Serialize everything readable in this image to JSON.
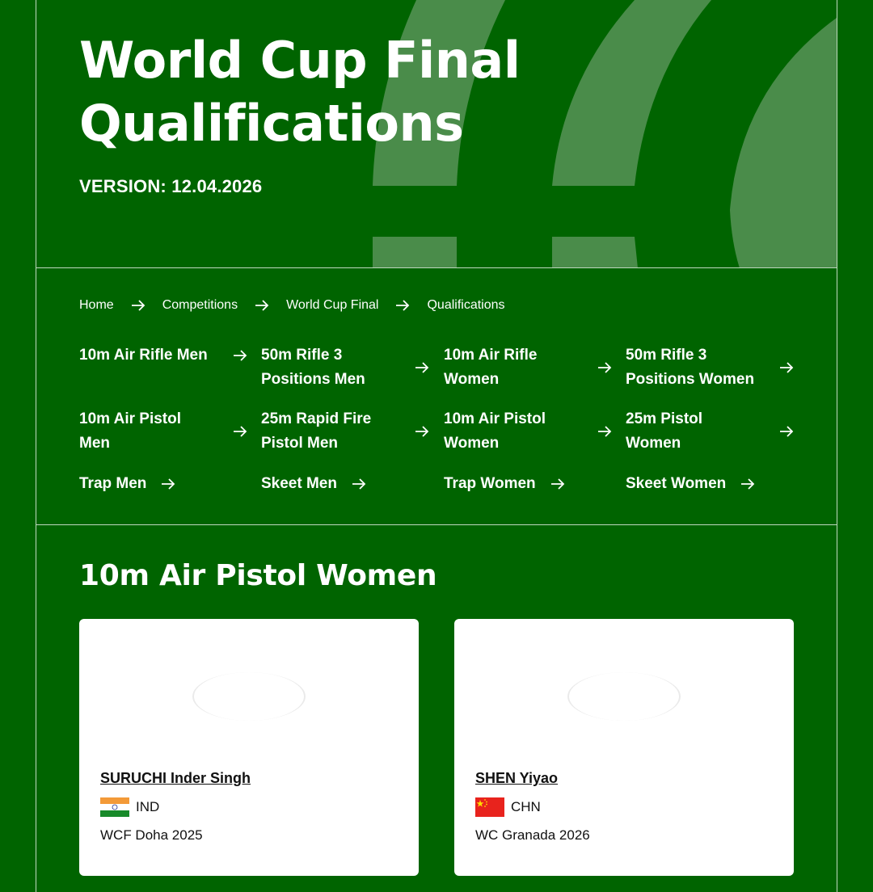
{
  "hero": {
    "title_line1": "World Cup Final",
    "title_line2": "Qualifications",
    "version": "VERSION: 12.04.2026"
  },
  "breadcrumb": [
    {
      "label": "Home"
    },
    {
      "label": "Competitions"
    },
    {
      "label": "World Cup Final"
    },
    {
      "label": "Qualifications"
    }
  ],
  "categories": [
    {
      "label": "10m Air Rifle Men"
    },
    {
      "label": "50m Rifle 3 Positions Men"
    },
    {
      "label": "10m Air Rifle Women"
    },
    {
      "label": "50m Rifle 3 Positions Women"
    },
    {
      "label": "10m Air Pistol Men"
    },
    {
      "label": "25m Rapid Fire Pistol Men"
    },
    {
      "label": "10m Air Pistol Women"
    },
    {
      "label": "25m Pistol Women"
    },
    {
      "label": "Trap Men"
    },
    {
      "label": "Skeet Men"
    },
    {
      "label": "Trap Women"
    },
    {
      "label": "Skeet Women"
    }
  ],
  "section": {
    "title": "10m Air Pistol Women"
  },
  "athletes": [
    {
      "name": "SURUCHI Inder Singh",
      "nation": "IND",
      "flag_icon": "india-flag-icon",
      "event": "WCF Doha 2025"
    },
    {
      "name": "SHEN Yiyao",
      "nation": "CHN",
      "flag_icon": "china-flag-icon",
      "event": "WC Granada 2026"
    }
  ],
  "colors": {
    "background": "#006400",
    "hero_shape": "#4a8c4a",
    "card": "#ffffff"
  }
}
